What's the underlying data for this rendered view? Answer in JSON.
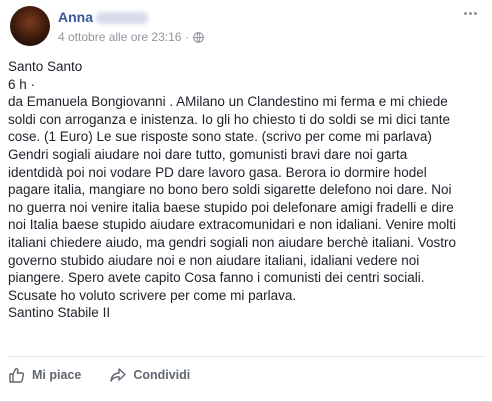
{
  "post": {
    "author_name": "Anna",
    "timestamp": "4 ottobre alle ore 23:16",
    "separator": "·",
    "lines": [
      "Santo Santo",
      "6 h ·",
      "da Emanuela Bongiovanni . AMilano un Clandestino mi ferma e mi chiede",
      "soldi con arroganza e inistenza. Io gli ho chiesto ti do soldi se mi dici tante",
      "cose. (1 Euro) Le sue risposte sono state. (scrivo per come mi parlava)",
      "Gendri sogiali aiudare noi dare tutto, gomunisti bravi dare noi garta",
      "identdidà poi noi vodare PD dare lavoro gasa. Berora io dormire hodel",
      "pagare italia, mangiare no bono bero soldi sigarette delefono noi dare. Noi",
      "no guerra noi venire italia baese stupido poi delefonare amigi fradelli e dire",
      "noi Italia baese stupido aiudare extracomunidari e non idaliani. Venire molti",
      "italiani chiedere aiudo, ma gendri sogiali non aiudare berchè italiani. Vostro",
      "governo stubido aiudare noi e non aiudare italiani, idaliani vedere noi",
      "piangere. Spero avete capito Cosa fanno i comunisti dei centri sociali.",
      "Scusate ho voluto scrivere per come mi parlava.",
      "Santino Stabile II"
    ]
  },
  "actions": {
    "like_label": "Mi piace",
    "share_label": "Condividi"
  },
  "icons": {
    "privacy": "globe-icon",
    "like": "thumbs-up-icon",
    "share": "share-arrow-icon",
    "more": "more-options-icon"
  },
  "colors": {
    "author": "#365899",
    "meta": "#90949c",
    "text": "#1d2129",
    "action": "#606770"
  }
}
